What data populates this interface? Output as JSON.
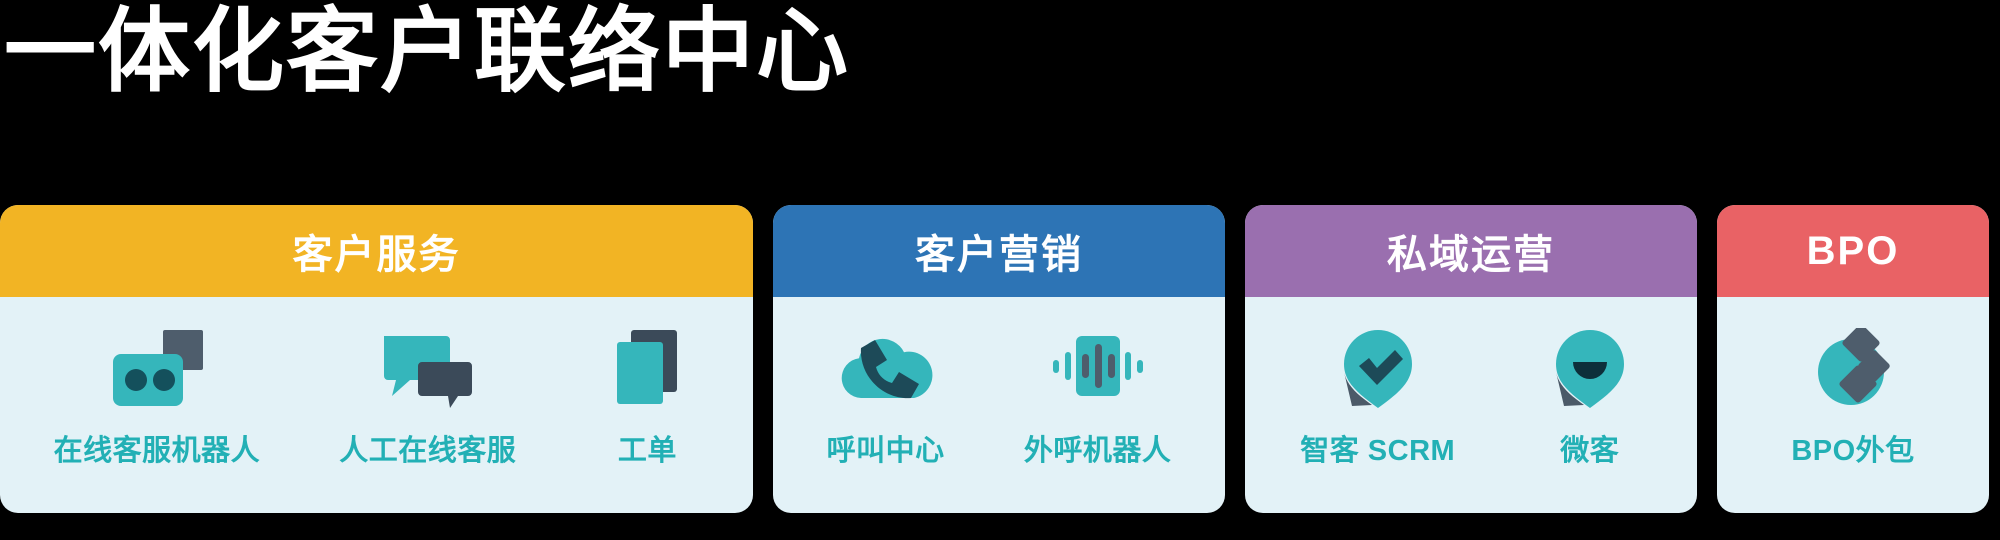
{
  "title": "一体化客户联络中心",
  "colors": {
    "title_text": "#ffffff",
    "background": "#000000",
    "card_body": "#e3f2f7",
    "label_text": "#22b0b5",
    "icon_teal": "#35b6bb",
    "icon_dark": "#4e5d6c",
    "icon_deep_teal": "#14505c",
    "card1_header": "#f2b424",
    "card2_header": "#2d74b5",
    "card3_header": "#9a6faf",
    "card4_header": "#e96265"
  },
  "cards": [
    {
      "id": "customer-service",
      "header": "客户服务",
      "header_color": "#f2b424",
      "items": [
        {
          "label": "在线客服机器人",
          "icon": "chat-robot-icon"
        },
        {
          "label": "人工在线客服",
          "icon": "chat-bubbles-icon"
        },
        {
          "label": "工单",
          "icon": "ticket-document-icon"
        }
      ]
    },
    {
      "id": "customer-marketing",
      "header": "客户营销",
      "header_color": "#2d74b5",
      "items": [
        {
          "label": "呼叫中心",
          "icon": "cloud-phone-icon"
        },
        {
          "label": "外呼机器人",
          "icon": "voice-waveform-icon"
        }
      ]
    },
    {
      "id": "private-domain-operations",
      "header": "私域运营",
      "header_color": "#9a6faf",
      "items": [
        {
          "label": "智客 SCRM",
          "icon": "pin-check-icon"
        },
        {
          "label": "微客",
          "icon": "pin-smile-icon"
        }
      ]
    },
    {
      "id": "bpo",
      "header": "BPO",
      "header_color": "#e96265",
      "items": [
        {
          "label": "BPO外包",
          "icon": "circle-diamonds-icon"
        }
      ]
    }
  ]
}
